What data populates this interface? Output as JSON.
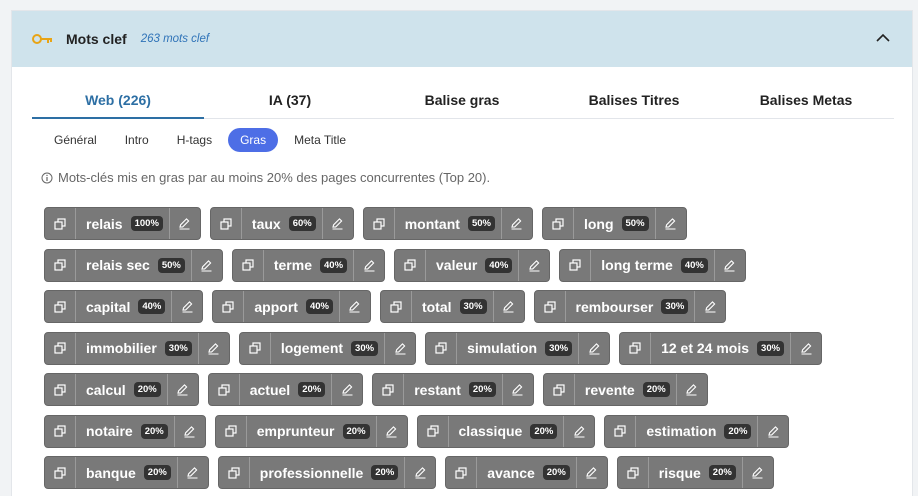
{
  "header": {
    "title": "Mots clef",
    "count": "263 mots clef",
    "icon": "key-icon",
    "collapse_icon": "chevron-up-icon"
  },
  "tabs": [
    {
      "label": "Web (226)",
      "active": true
    },
    {
      "label": "IA (37)",
      "active": false
    },
    {
      "label": "Balise gras",
      "active": false
    },
    {
      "label": "Balises Titres",
      "active": false
    },
    {
      "label": "Balises Metas",
      "active": false
    }
  ],
  "subtabs": [
    {
      "label": "Général",
      "active": false
    },
    {
      "label": "Intro",
      "active": false
    },
    {
      "label": "H-tags",
      "active": false
    },
    {
      "label": "Gras",
      "active": true
    },
    {
      "label": "Meta Title",
      "active": false
    }
  ],
  "info_text": "Mots-clés mis en gras par au moins 20% des pages concurrentes (Top 20).",
  "colors": {
    "chip_bg": "#797979",
    "accent": "#4d6ee6",
    "header_bg": "#cfe3ec",
    "key": "#e8a415"
  },
  "keyword_rows": [
    [
      {
        "kw": "relais",
        "pct": "100%"
      },
      {
        "kw": "taux",
        "pct": "60%"
      },
      {
        "kw": "montant",
        "pct": "50%"
      },
      {
        "kw": "long",
        "pct": "50%"
      }
    ],
    [
      {
        "kw": "relais sec",
        "pct": "50%"
      },
      {
        "kw": "terme",
        "pct": "40%"
      },
      {
        "kw": "valeur",
        "pct": "40%"
      },
      {
        "kw": "long terme",
        "pct": "40%"
      }
    ],
    [
      {
        "kw": "capital",
        "pct": "40%"
      },
      {
        "kw": "apport",
        "pct": "40%"
      },
      {
        "kw": "total",
        "pct": "30%"
      },
      {
        "kw": "rembourser",
        "pct": "30%"
      }
    ],
    [
      {
        "kw": "immobilier",
        "pct": "30%"
      },
      {
        "kw": "logement",
        "pct": "30%"
      },
      {
        "kw": "simulation",
        "pct": "30%"
      },
      {
        "kw": "12 et 24 mois",
        "pct": "30%"
      }
    ],
    [
      {
        "kw": "calcul",
        "pct": "20%"
      },
      {
        "kw": "actuel",
        "pct": "20%"
      },
      {
        "kw": "restant",
        "pct": "20%"
      },
      {
        "kw": "revente",
        "pct": "20%"
      }
    ],
    [
      {
        "kw": "notaire",
        "pct": "20%"
      },
      {
        "kw": "emprunteur",
        "pct": "20%"
      },
      {
        "kw": "classique",
        "pct": "20%"
      },
      {
        "kw": "estimation",
        "pct": "20%"
      }
    ],
    [
      {
        "kw": "banque",
        "pct": "20%"
      },
      {
        "kw": "professionnelle",
        "pct": "20%"
      },
      {
        "kw": "avance",
        "pct": "20%"
      },
      {
        "kw": "risque",
        "pct": "20%"
      }
    ]
  ]
}
